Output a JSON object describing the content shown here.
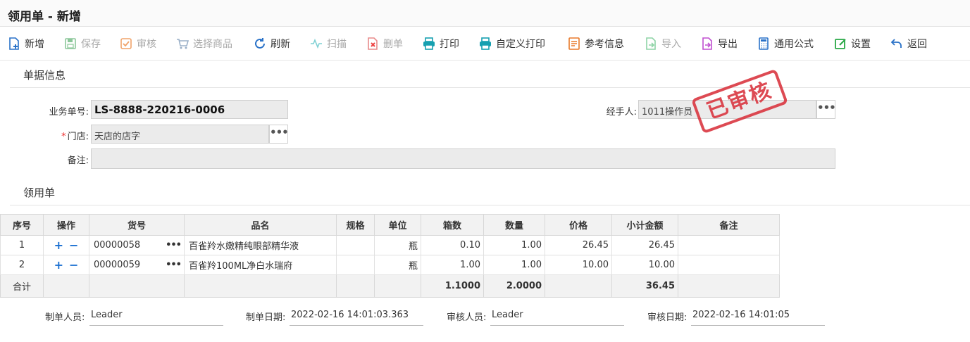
{
  "header": {
    "title": "领用单 - 新增"
  },
  "toolbar": [
    {
      "label": "新增",
      "icon": "new-doc-icon",
      "enabled": true
    },
    {
      "label": "保存",
      "icon": "save-icon",
      "enabled": false
    },
    {
      "label": "审核",
      "icon": "check-icon",
      "enabled": false
    },
    {
      "label": "选择商品",
      "icon": "cart-icon",
      "enabled": false
    },
    {
      "label": "刷新",
      "icon": "refresh-icon",
      "enabled": true
    },
    {
      "label": "扫描",
      "icon": "scan-icon",
      "enabled": false
    },
    {
      "label": "删单",
      "icon": "delete-doc-icon",
      "enabled": false
    },
    {
      "label": "打印",
      "icon": "print-icon",
      "enabled": true
    },
    {
      "label": "自定义打印",
      "icon": "custom-print-icon",
      "enabled": true
    },
    {
      "label": "参考信息",
      "icon": "reference-icon",
      "enabled": true
    },
    {
      "label": "导入",
      "icon": "import-icon",
      "enabled": false
    },
    {
      "label": "导出",
      "icon": "export-icon",
      "enabled": true
    },
    {
      "label": "通用公式",
      "icon": "calculator-icon",
      "enabled": true
    },
    {
      "label": "设置",
      "icon": "settings-edit-icon",
      "enabled": true
    },
    {
      "label": "返回",
      "icon": "back-arrow-icon",
      "enabled": true
    }
  ],
  "form": {
    "section_title": "单据信息",
    "business_no_label": "业务单号:",
    "business_no": "LS-8888-220216-0006",
    "handler_label": "经手人:",
    "handler": "1011操作员",
    "store_required": "*",
    "store_label": "门店:",
    "store": "天店的店字",
    "remark_label": "备注:",
    "remark": ""
  },
  "stamp": {
    "text": "已审核",
    "color": "#d9323c"
  },
  "grid": {
    "section_title": "领用单",
    "columns": [
      "序号",
      "操作",
      "货号",
      "品名",
      "规格",
      "单位",
      "箱数",
      "数量",
      "价格",
      "小计金额",
      "备注"
    ],
    "rows": [
      {
        "seq": "1",
        "code": "00000058",
        "name": "百雀羚水嫩精纯眼部精华液",
        "spec": "",
        "unit": "瓶",
        "boxes": "0.10",
        "qty": "1.00",
        "price": "26.45",
        "subtotal": "26.45",
        "remark": ""
      },
      {
        "seq": "2",
        "code": "00000059",
        "name": "百雀羚100ML净白水瑞府",
        "spec": "",
        "unit": "瓶",
        "boxes": "1.00",
        "qty": "1.00",
        "price": "10.00",
        "subtotal": "10.00",
        "remark": ""
      }
    ],
    "total": {
      "label": "合计",
      "boxes": "1.1000",
      "qty": "2.0000",
      "subtotal": "36.45"
    },
    "row_actions": {
      "add": "+",
      "remove": "−",
      "more": "•••"
    }
  },
  "footer": {
    "maker_label": "制单人员:",
    "maker": "Leader",
    "make_date_label": "制单日期:",
    "make_date": "2022-02-16 14:01:03.363",
    "auditor_label": "审核人员:",
    "auditor": "Leader",
    "audit_date_label": "审核日期:",
    "audit_date": "2022-02-16 14:01:05"
  },
  "colors": {
    "accent_blue": "#1a6fd1",
    "stamp_red": "#d9323c",
    "header_bg": "#f2f2f2"
  }
}
